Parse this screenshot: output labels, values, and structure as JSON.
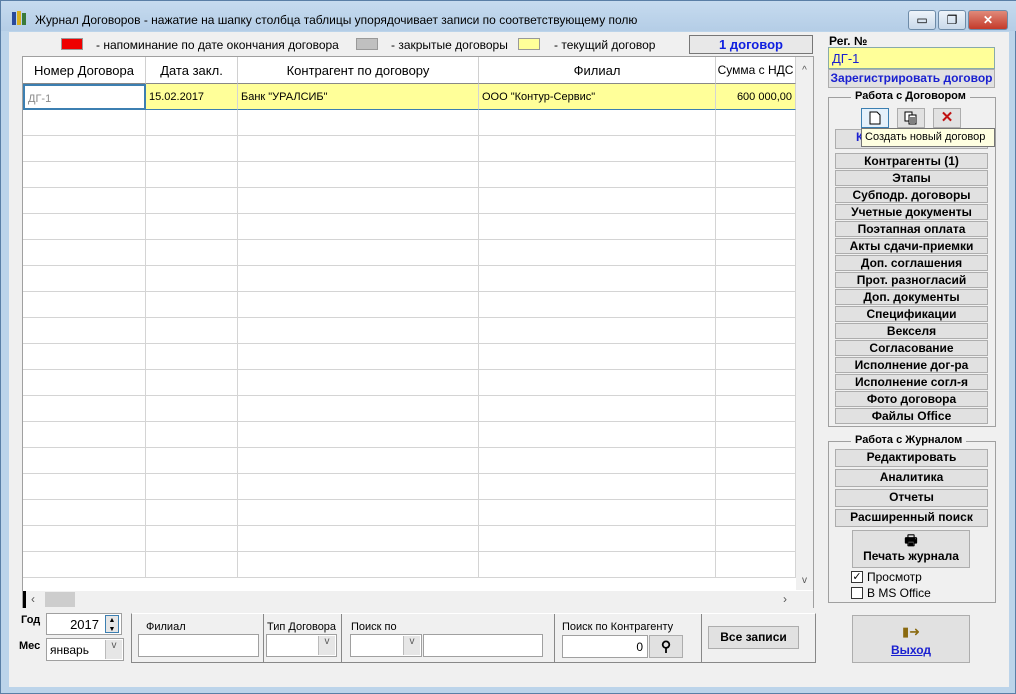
{
  "window": {
    "title": "Журнал Договоров - нажатие на шапку столбца таблицы упорядочивает записи по соответствующему полю",
    "minimize": "▭",
    "restore": "❐",
    "close": "✕"
  },
  "legend": {
    "reminder": "- напоминание по дате окончания договора",
    "closed": "- закрытые договоры",
    "current": "- текущий договор",
    "colors": {
      "reminder": "#ee0000",
      "closed": "#c0c0c0",
      "current": "#ffff99"
    }
  },
  "count_label": "1 договор",
  "table": {
    "columns": [
      "Номер Договора",
      "Дата закл.",
      "Контрагент по договору",
      "Филиал",
      "Сумма с НДС"
    ],
    "rows": [
      [
        "ДГ-1",
        "15.02.2017",
        "Банк \"УРАЛСИБ\"",
        "ООО \"Контур-Сервис\"",
        "600 000,00"
      ]
    ]
  },
  "reg": {
    "label": "Рег. №",
    "value": "ДГ-1",
    "register_button": "Зарегистрировать договор"
  },
  "contract_panel": {
    "title": "Работа с Договором",
    "tooltip": "Создать новый договор",
    "first_button_visible": "К",
    "buttons": [
      "Контрагенты (1)",
      "Этапы",
      "Субподр. договоры",
      "Учетные документы",
      "Поэтапная оплата",
      "Акты сдачи-приемки",
      "Доп. соглашения",
      "Прот. разногласий",
      "Доп. документы",
      "Спецификации",
      "Векселя",
      "Согласование",
      "Исполнение дог-ра",
      "Исполнение согл-я",
      "Фото договора",
      "Файлы Office"
    ]
  },
  "journal_panel": {
    "title": "Работа с Журналом",
    "buttons": [
      "Редактировать",
      "Аналитика",
      "Отчеты",
      "Расширенный поиск"
    ],
    "print": "Печать журнала",
    "preview": "Просмотр",
    "preview_checked": true,
    "ms_office": "В MS Office",
    "ms_office_checked": false
  },
  "exit": "Выход",
  "filters": {
    "year_label": "Год",
    "year": "2017",
    "month_label": "Мес",
    "month": "январь",
    "branch_label": "Филиал",
    "branch": "",
    "type_label": "Тип Договора",
    "type": "",
    "search_by_label": "Поиск по",
    "search_by": "",
    "search_text": "",
    "counterparty_label": "Поиск по Контрагенту",
    "counterparty_value": "0",
    "all_records": "Все записи"
  }
}
